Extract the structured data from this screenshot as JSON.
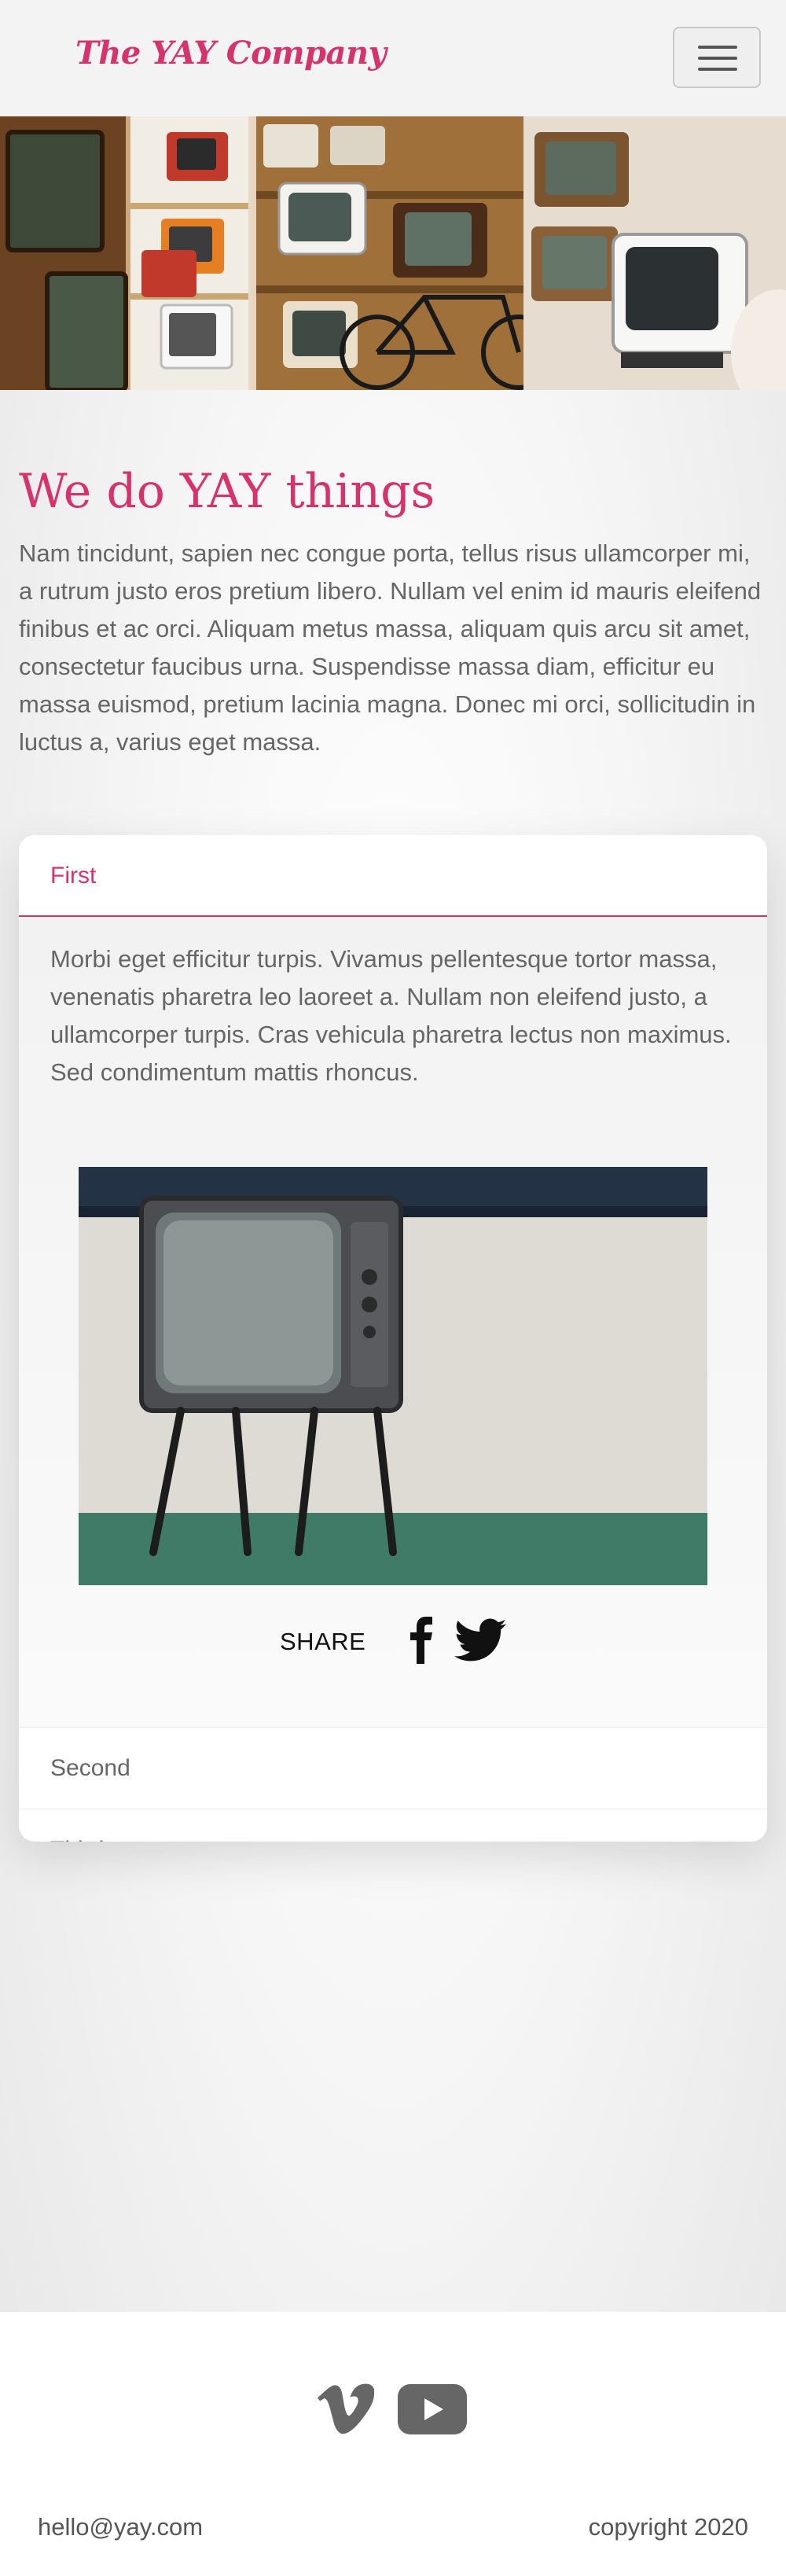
{
  "header": {
    "brand": "The YAY Company",
    "menu_icon": "hamburger-icon"
  },
  "intro": {
    "title": "We do YAY things",
    "text": "Nam tincidunt, sapien nec congue porta, tellus risus ullamcorper mi, a rutrum justo eros pretium libero. Nullam vel enim id mauris eleifend finibus et ac orci. Aliquam metus massa, aliquam quis arcu sit amet, consectetur faucibus urna. Suspendisse massa diam, efficitur eu massa euismod, pretium lacinia magna. Donec mi orci, sollicitudin in luctus a, varius eget massa."
  },
  "accordion": {
    "items": [
      {
        "label": "First",
        "expanded": true,
        "text": "Morbi eget efficitur turpis. Vivamus pellentesque tortor massa, venenatis pharetra leo laoreet a. Nullam non eleifend justo, a ullamcorper turpis. Cras vehicula pharetra lectus non maximus. Sed condimentum mattis rhoncus.",
        "share_label": "SHARE"
      },
      {
        "label": "Second",
        "expanded": false
      },
      {
        "label": "Third",
        "expanded": false
      }
    ]
  },
  "footer": {
    "email": "hello@yay.com",
    "copyright": "copyright 2020",
    "social_icons": [
      "vimeo-icon",
      "youtube-icon"
    ]
  },
  "colors": {
    "accent": "#d6336c",
    "text": "#666666",
    "background": "#f3f3f3"
  }
}
